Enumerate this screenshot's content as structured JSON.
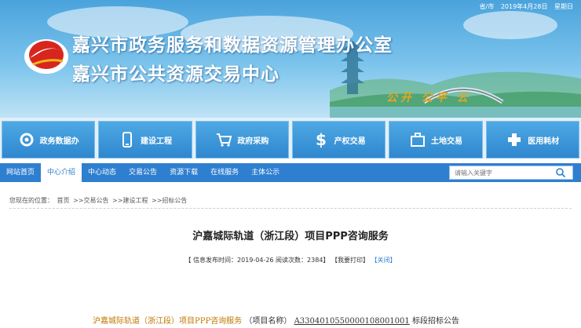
{
  "header": {
    "date_prefix": "省/市",
    "date": "2019年4月28日",
    "weekday": "星期日",
    "title_line1": "嘉兴市政务服务和数据资源管理办公室",
    "title_line2": "嘉兴市公共资源交易中心",
    "slogan": "公开 公平 公"
  },
  "categories": [
    {
      "label": "政务数据办",
      "icon": "gear-icon"
    },
    {
      "label": "建设工程",
      "icon": "phone-icon"
    },
    {
      "label": "政府采购",
      "icon": "cart-icon"
    },
    {
      "label": "产权交易",
      "icon": "dollar-icon"
    },
    {
      "label": "土地交易",
      "icon": "briefcase-icon"
    },
    {
      "label": "医用耗材",
      "icon": "plus-icon"
    }
  ],
  "nav": {
    "items": [
      "网站首页",
      "中心介绍",
      "中心动态",
      "交易公告",
      "资源下载",
      "在线服务",
      "主体公示"
    ],
    "active_index": 1
  },
  "search": {
    "placeholder": "请输入关键字"
  },
  "breadcrumb": {
    "prefix": "您现在的位置：",
    "items": [
      "首页",
      ">>交易公告",
      ">>建设工程",
      ">>招标公告"
    ]
  },
  "article": {
    "title": "沪嘉城际轨道（浙江段）项目PPP咨询服务",
    "meta_publish": "【 信息发布时间：2019-04-26  阅读次数：2384】",
    "meta_print": "【我要打印】",
    "meta_close": "【关闭】",
    "body_name": "沪嘉城际轨道（浙江段）项目PPP咨询服务",
    "body_mid": "（项目名称）",
    "body_code": "A3304010550000108001001",
    "body_tail": "标段招标公告"
  },
  "colors": {
    "accent": "#2f7fd0",
    "slogan": "#e8a61a",
    "highlight": "#c07800"
  }
}
